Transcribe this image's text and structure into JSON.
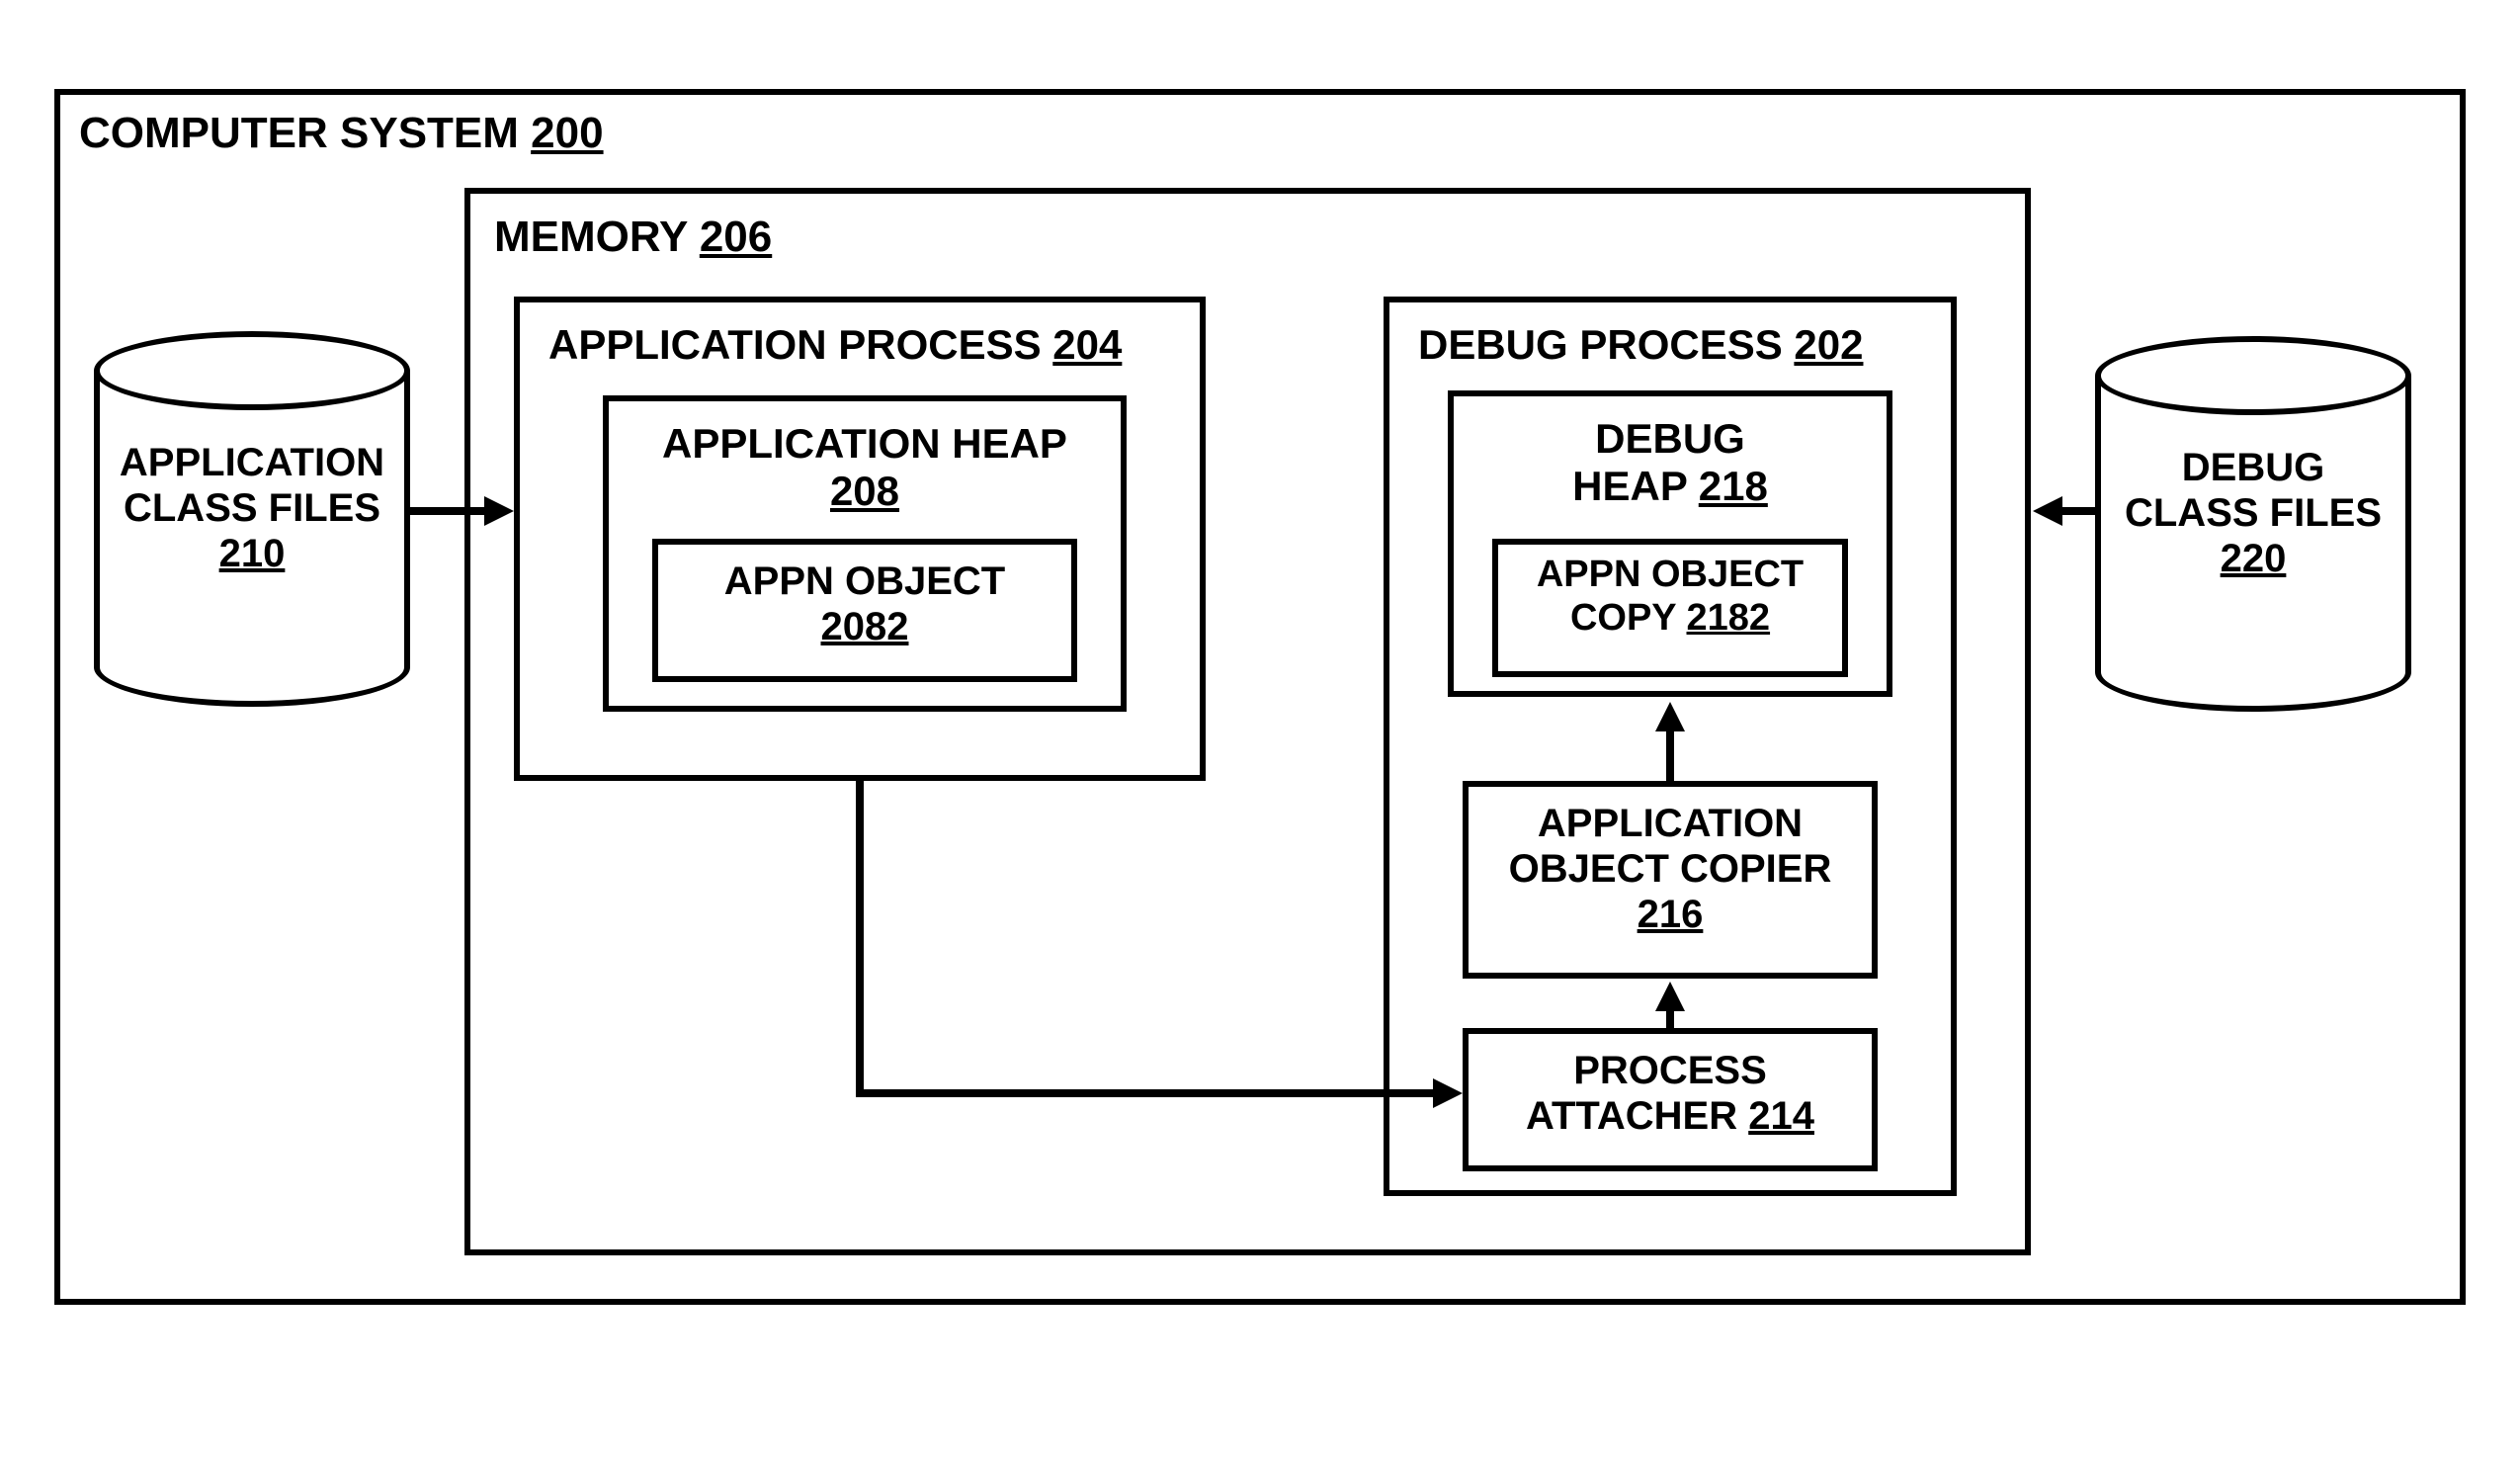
{
  "computer_system": {
    "label": "COMPUTER SYSTEM",
    "ref": "200"
  },
  "memory": {
    "label": "MEMORY",
    "ref": "206"
  },
  "app_process": {
    "label": "APPLICATION PROCESS",
    "ref": "204"
  },
  "app_heap": {
    "label": "APPLICATION HEAP",
    "ref": "208"
  },
  "appn_object": {
    "label": "APPN OBJECT",
    "ref": "2082"
  },
  "debug_process": {
    "label": "DEBUG PROCESS",
    "ref": "202"
  },
  "debug_heap": {
    "label": "DEBUG",
    "label2": "HEAP",
    "ref": "218"
  },
  "appn_object_copy": {
    "label": "APPN OBJECT",
    "label2": "COPY",
    "ref": "2182"
  },
  "app_object_copier": {
    "label": "APPLICATION",
    "label2": "OBJECT COPIER",
    "ref": "216"
  },
  "process_attacher": {
    "label": "PROCESS",
    "label2": "ATTACHER",
    "ref": "214"
  },
  "app_class_files": {
    "label": "APPLICATION",
    "label2": "CLASS FILES",
    "ref": "210"
  },
  "debug_class_files": {
    "label": "DEBUG",
    "label2": "CLASS FILES",
    "ref": "220"
  }
}
